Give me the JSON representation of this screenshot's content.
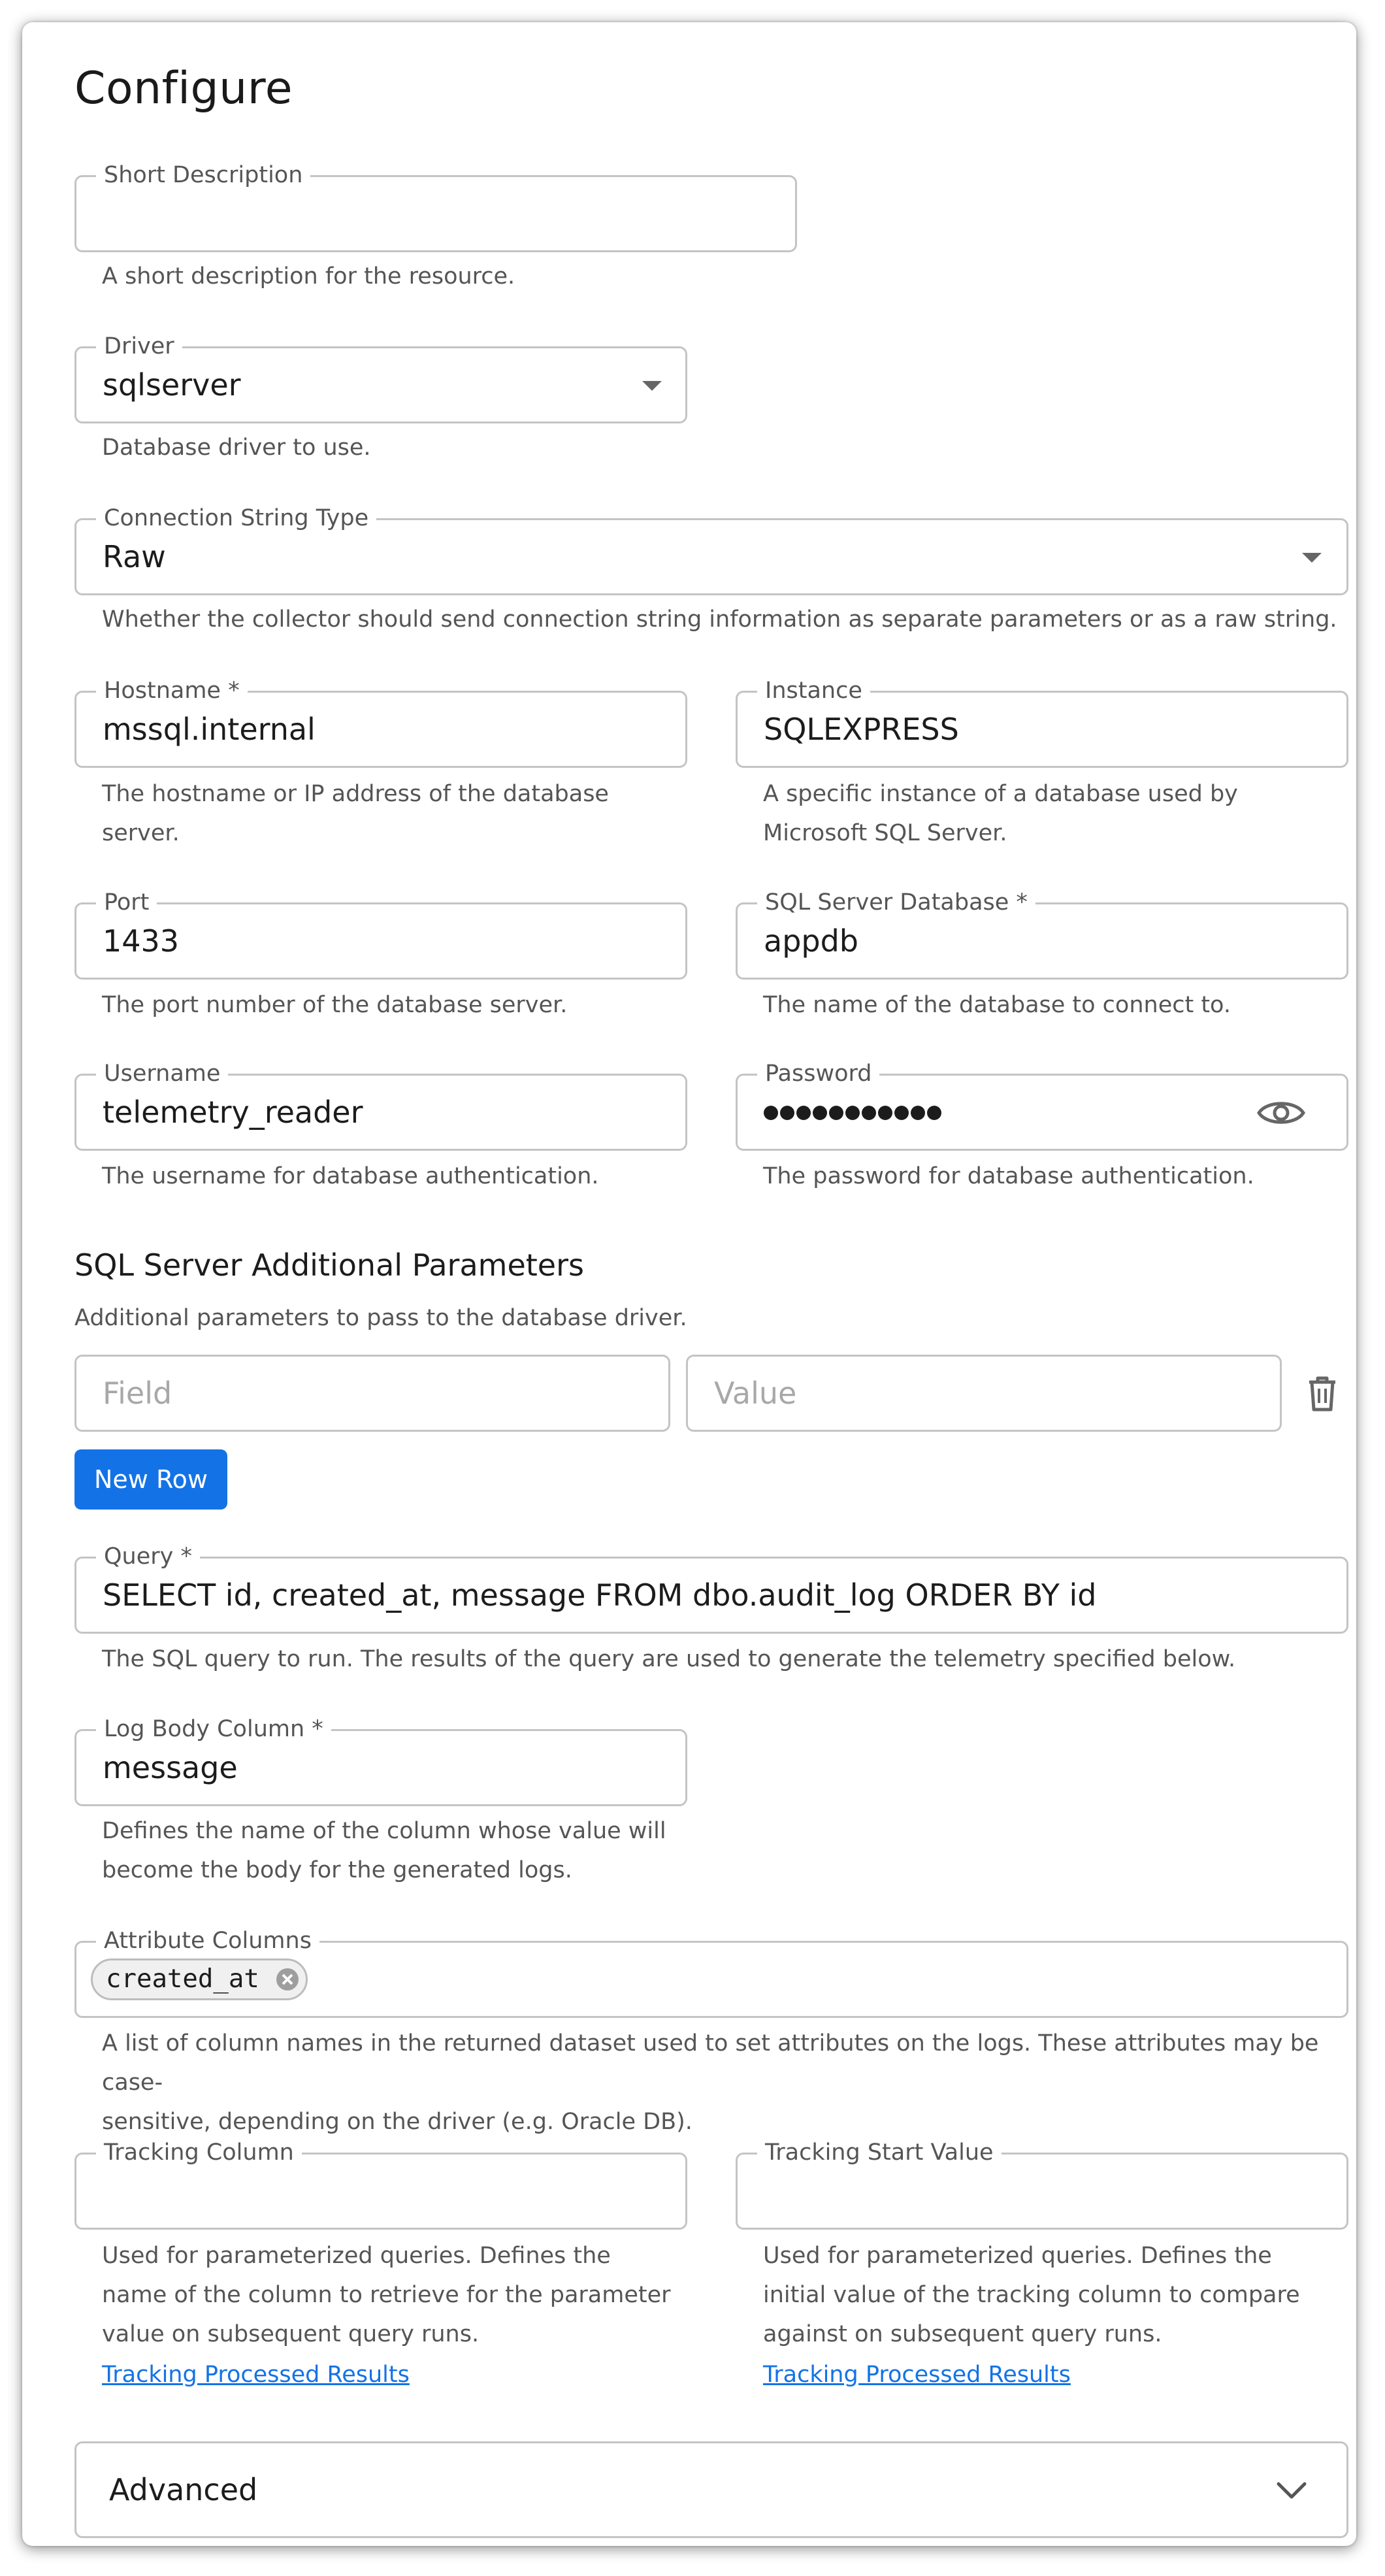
{
  "title": "Configure",
  "short_description": {
    "label": "Short Description",
    "value": "",
    "help": "A short description for the resource."
  },
  "driver": {
    "label": "Driver",
    "value": "sqlserver",
    "help": "Database driver to use."
  },
  "connection_string_type": {
    "label": "Connection String Type",
    "value": "Raw",
    "help": "Whether the collector should send connection string information as separate parameters or as a raw string."
  },
  "hostname": {
    "label": "Hostname *",
    "value": "mssql.internal",
    "help_line1": "The hostname or IP address of the database",
    "help_line2": "server."
  },
  "instance": {
    "label": "Instance",
    "value": "SQLEXPRESS",
    "help_line1": "A specific instance of a database used by",
    "help_line2": "Microsoft SQL Server."
  },
  "port": {
    "label": "Port",
    "value": "1433",
    "help": "The port number of the database server."
  },
  "database": {
    "label": "SQL Server Database *",
    "value": "appdb",
    "help": "The name of the database to connect to."
  },
  "username": {
    "label": "Username",
    "value": "telemetry_reader",
    "help": "The username for database authentication."
  },
  "password": {
    "label": "Password",
    "masked_length": 11,
    "help": "The password for database authentication."
  },
  "additional_params": {
    "heading": "SQL Server Additional Parameters",
    "help": "Additional parameters to pass to the database driver.",
    "field_placeholder": "Field",
    "value_placeholder": "Value",
    "new_row_label": "New Row"
  },
  "query": {
    "label": "Query *",
    "value": "SELECT id, created_at, message FROM dbo.audit_log ORDER BY id",
    "help": "The SQL query to run. The results of the query are used to generate the telemetry specified below."
  },
  "log_body_column": {
    "label": "Log Body Column *",
    "value": "message",
    "help_line1": "Defines the name of the column whose value will",
    "help_line2": "become the body for the generated logs."
  },
  "attribute_columns": {
    "label": "Attribute Columns",
    "chips": [
      "created_at"
    ],
    "help_line1": "A list of column names in the returned dataset used to set attributes on the logs. These attributes may be case-",
    "help_line2": "sensitive, depending on the driver (e.g. Oracle DB)."
  },
  "tracking_column": {
    "label": "Tracking Column",
    "value": "",
    "help_line1": "Used for parameterized queries. Defines the",
    "help_line2": "name of the column to retrieve for the parameter",
    "help_line3": "value on subsequent query runs.",
    "link": "Tracking Processed Results"
  },
  "tracking_start_value": {
    "label": "Tracking Start Value",
    "value": "",
    "help_line1": "Used for parameterized queries. Defines the",
    "help_line2": "initial value of the tracking column to compare",
    "help_line3": "against on subsequent query runs.",
    "link": "Tracking Processed Results"
  },
  "advanced": {
    "label": "Advanced"
  },
  "colors": {
    "accent": "#1373e6",
    "border": "#c4c4c4",
    "help_text": "#555555"
  },
  "icons": {
    "select_caret": "caret-down-icon",
    "password_toggle": "eye-icon",
    "delete_row": "trash-icon",
    "chip_remove": "close-circle-icon",
    "expand": "chevron-down-icon"
  }
}
